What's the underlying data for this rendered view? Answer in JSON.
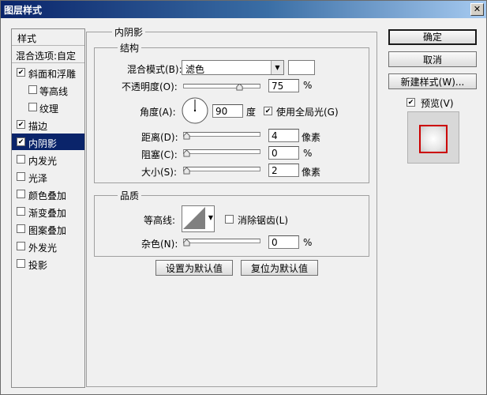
{
  "window": {
    "title": "图层样式",
    "close_glyph": "✕"
  },
  "left_panel": {
    "header": "样式",
    "blend_options": "混合选项:自定",
    "items": [
      {
        "label": "斜面和浮雕",
        "checked": true,
        "selected": false,
        "indent": false
      },
      {
        "label": "等高线",
        "checked": false,
        "selected": false,
        "indent": true
      },
      {
        "label": "纹理",
        "checked": false,
        "selected": false,
        "indent": true
      },
      {
        "label": "描边",
        "checked": true,
        "selected": false,
        "indent": false
      },
      {
        "label": "内阴影",
        "checked": true,
        "selected": true,
        "indent": false
      },
      {
        "label": "内发光",
        "checked": false,
        "selected": false,
        "indent": false
      },
      {
        "label": "光泽",
        "checked": false,
        "selected": false,
        "indent": false
      },
      {
        "label": "颜色叠加",
        "checked": false,
        "selected": false,
        "indent": false
      },
      {
        "label": "渐变叠加",
        "checked": false,
        "selected": false,
        "indent": false
      },
      {
        "label": "图案叠加",
        "checked": false,
        "selected": false,
        "indent": false
      },
      {
        "label": "外发光",
        "checked": false,
        "selected": false,
        "indent": false
      },
      {
        "label": "投影",
        "checked": false,
        "selected": false,
        "indent": false
      }
    ]
  },
  "inner_shadow": {
    "title": "内阴影",
    "structure": {
      "title": "结构",
      "blend_mode_label": "混合模式(B):",
      "blend_mode_value": "滤色",
      "blend_color": "#ffffff",
      "opacity_label": "不透明度(O):",
      "opacity_value": "75",
      "opacity_unit": "%",
      "opacity_fraction": 0.75,
      "angle_label": "角度(A):",
      "angle_value": "90",
      "angle_unit": "度",
      "use_global_light_label": "使用全局光(G)",
      "use_global_light_checked": true,
      "distance_label": "距离(D):",
      "distance_value": "4",
      "distance_unit": "像素",
      "choke_label": "阻塞(C):",
      "choke_value": "0",
      "choke_unit": "%",
      "size_label": "大小(S):",
      "size_value": "2",
      "size_unit": "像素"
    },
    "quality": {
      "title": "品质",
      "contour_label": "等高线:",
      "anti_alias_label": "消除锯齿(L)",
      "anti_alias_checked": false,
      "noise_label": "杂色(N):",
      "noise_value": "0",
      "noise_unit": "%"
    },
    "make_default": "设置为默认值",
    "reset_default": "复位为默认值"
  },
  "right_panel": {
    "ok": "确定",
    "cancel": "取消",
    "new_style": "新建样式(W)...",
    "preview_label": "预览(V)",
    "preview_checked": true,
    "preview_border_color": "#cc0000"
  }
}
